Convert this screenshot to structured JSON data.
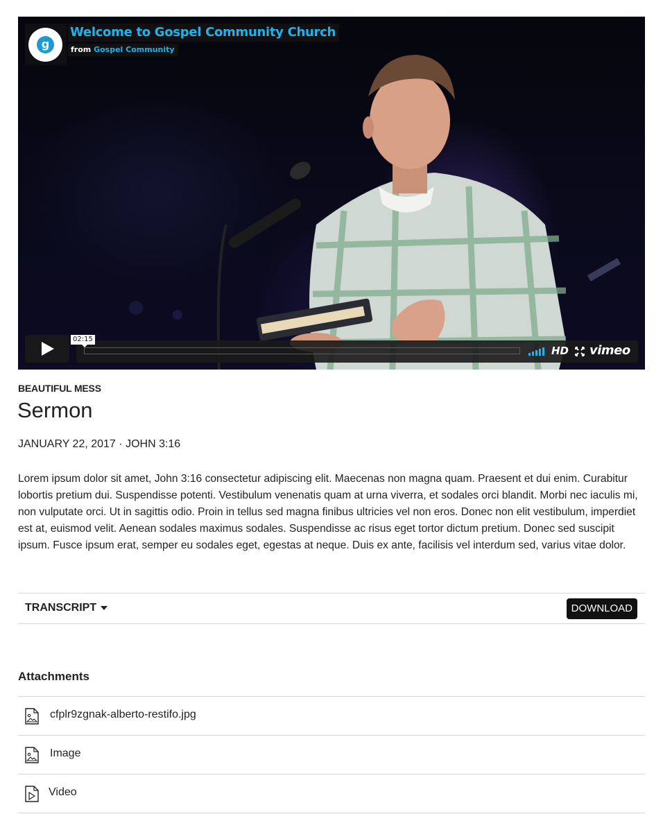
{
  "video": {
    "title": "Welcome to Gospel Community Church",
    "from_prefix": "from",
    "owner": "Gospel Community",
    "logo_glyph": "g",
    "current_time": "02:15",
    "hd_label": "HD",
    "brand": "vimeo",
    "accent_color": "#1fb3ee",
    "icons": [
      "play-icon",
      "volume-icon",
      "fullscreen-icon"
    ]
  },
  "sermon": {
    "series": "BEAUTIFUL MESS",
    "title": "Sermon",
    "date": "JANUARY 22, 2017",
    "separator": "·",
    "scripture": "JOHN 3:16",
    "description_before": "Lorem ipsum dolor sit amet, ",
    "description_link": "John 3:16",
    "description_after": " consectetur adipiscing elit. Maecenas non magna quam. Praesent et dui enim. Curabitur lobortis pretium dui. Suspendisse potenti. Vestibulum venenatis quam at urna viverra, et sodales orci blandit. Morbi nec iaculis mi, non vulputate orci. Ut in sagittis odio. Proin in tellus sed magna finibus ultricies vel non eros. Donec non elit vestibulum, imperdiet est at, euismod velit. Aenean sodales maximus sodales. Suspendisse ac risus eget tortor dictum pretium. Donec sed suscipit ipsum. Fusce ipsum erat, semper eu sodales eget, egestas at neque. Duis ex ante, facilisis vel interdum sed, varius vitae dolor."
  },
  "transcript": {
    "label": "TRANSCRIPT",
    "download_label": "DOWNLOAD"
  },
  "attachments": {
    "heading": "Attachments",
    "items": [
      {
        "name": "cfplr9zgnak-alberto-restifo.jpg",
        "icon": "image-file-icon"
      },
      {
        "name": "Image",
        "icon": "image-file-icon"
      },
      {
        "name": "Video",
        "icon": "video-file-icon"
      }
    ]
  }
}
